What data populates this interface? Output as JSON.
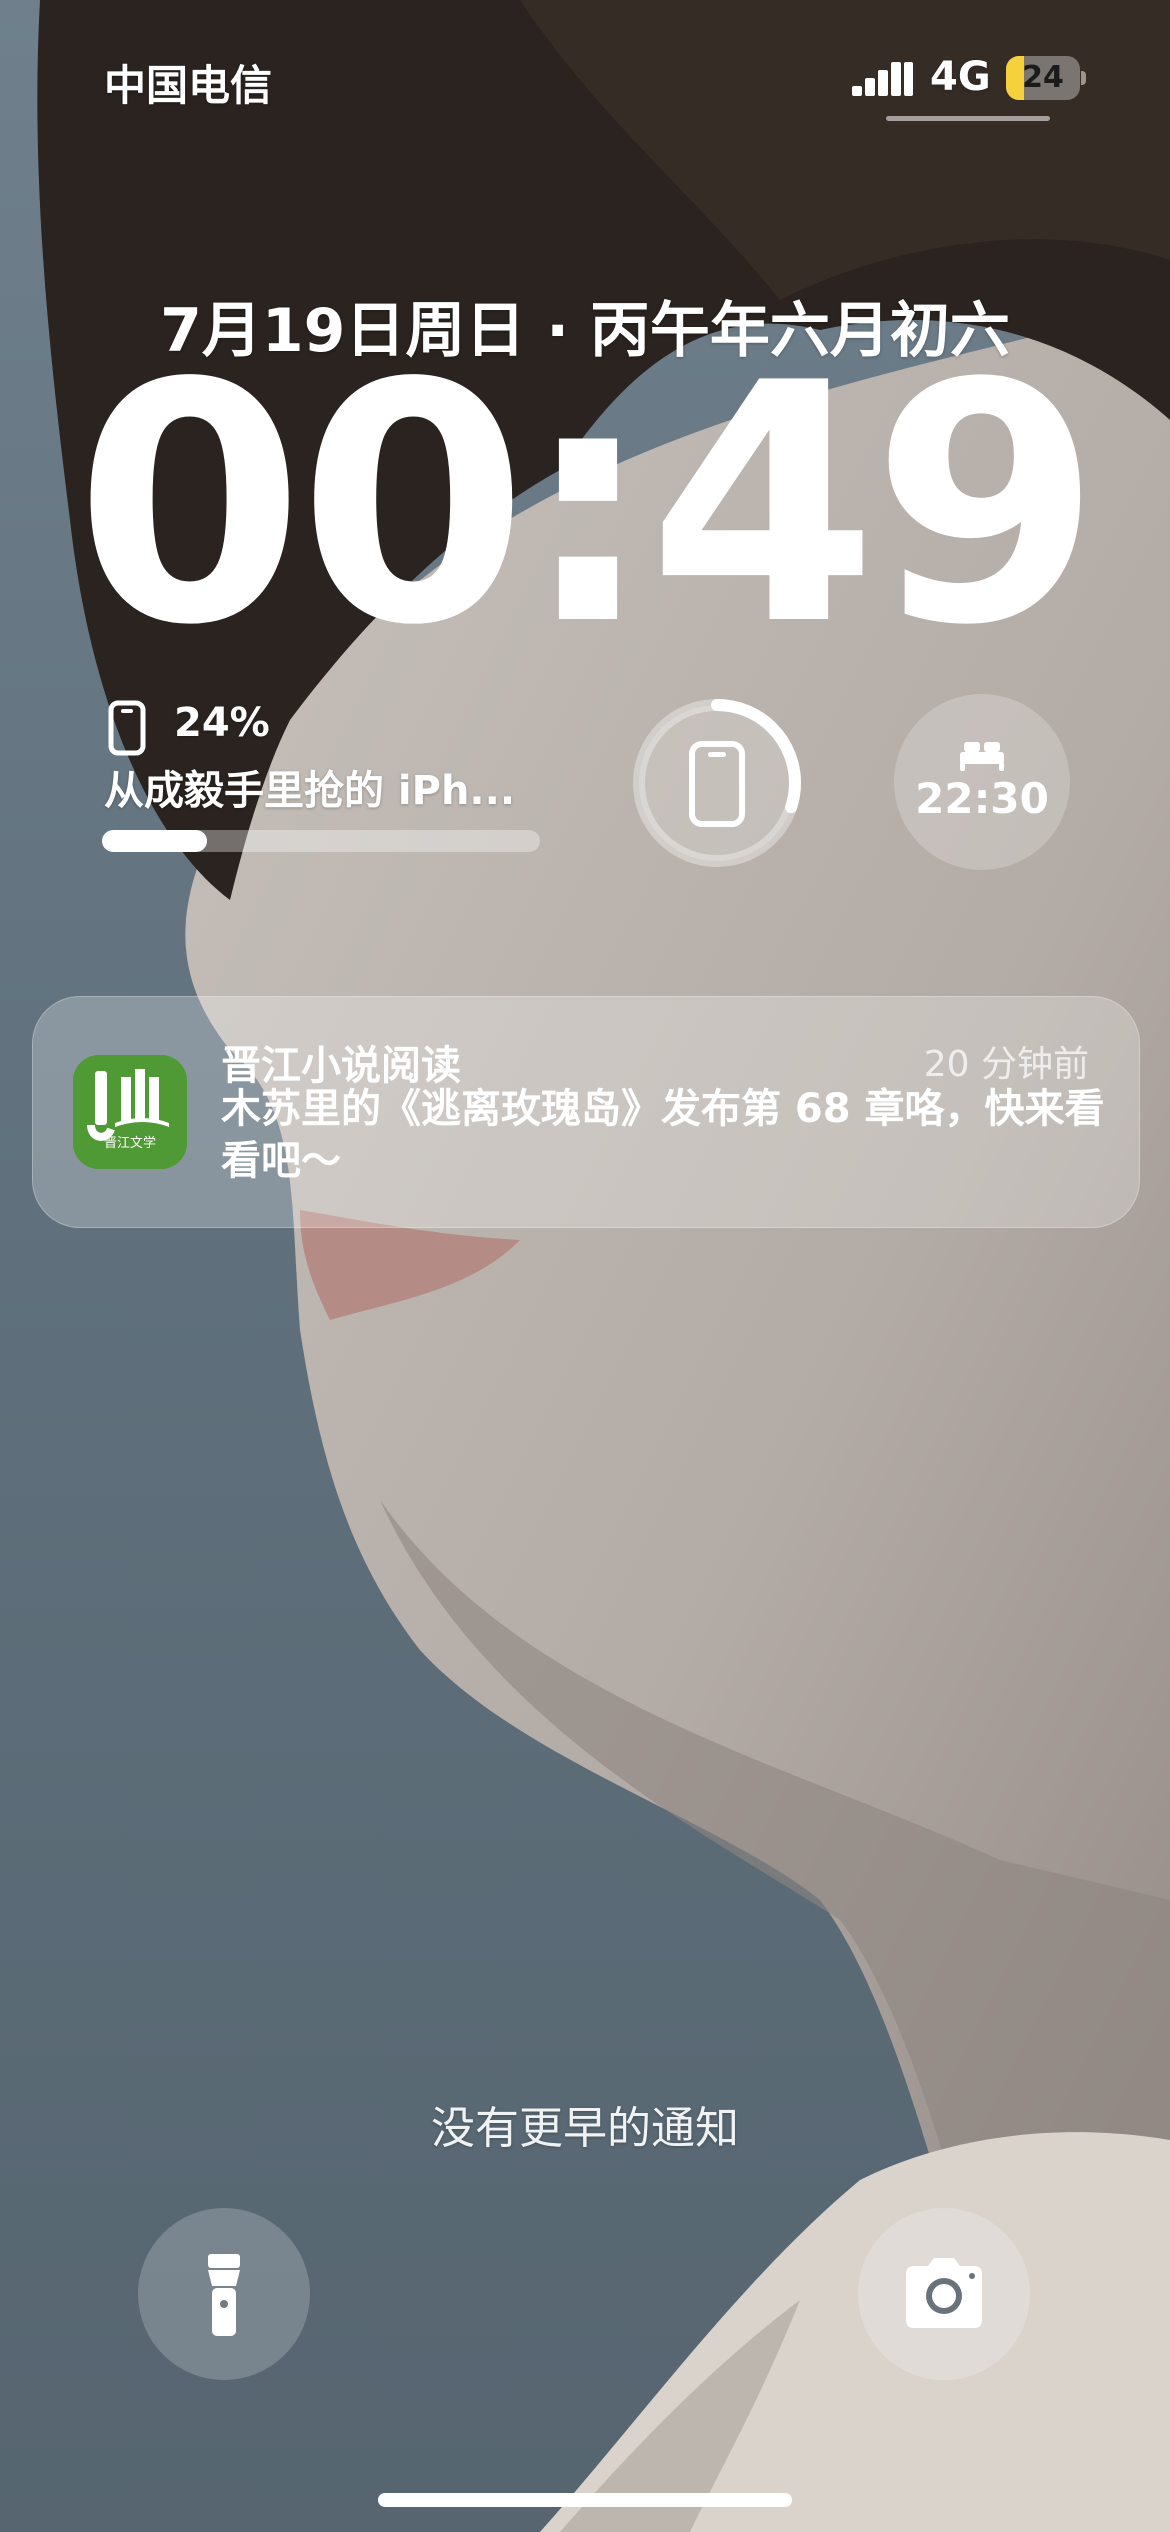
{
  "status_bar": {
    "carrier": "中国电信",
    "network": "4G",
    "battery_level": "24"
  },
  "lock_screen": {
    "date": "7月19日周日 · 丙午年六月初六",
    "time": "00:49"
  },
  "widgets": {
    "battery": {
      "percent": "24%",
      "device_name": "从成毅手里抢的 iPh...",
      "level_fraction": 0.24
    },
    "ring": {
      "icon": "phone-icon",
      "level_fraction": 0.3
    },
    "alarm": {
      "icon": "bed-icon",
      "time": "22:30"
    }
  },
  "notification": {
    "app_name": "晋江小说阅读",
    "time_ago": "20 分钟前",
    "body": "木苏里的《逃离玫瑰岛》发布第 68 章咯，快来看看吧～",
    "app_icon": "jinjiang-app-icon",
    "app_icon_text": "晋江文学"
  },
  "footer": {
    "no_older_notifications": "没有更早的通知",
    "flashlight_icon": "flashlight-icon",
    "camera_icon": "camera-icon"
  },
  "colors": {
    "battery_fill": "#f5d23c",
    "app_icon_green": "#4f9a34"
  }
}
